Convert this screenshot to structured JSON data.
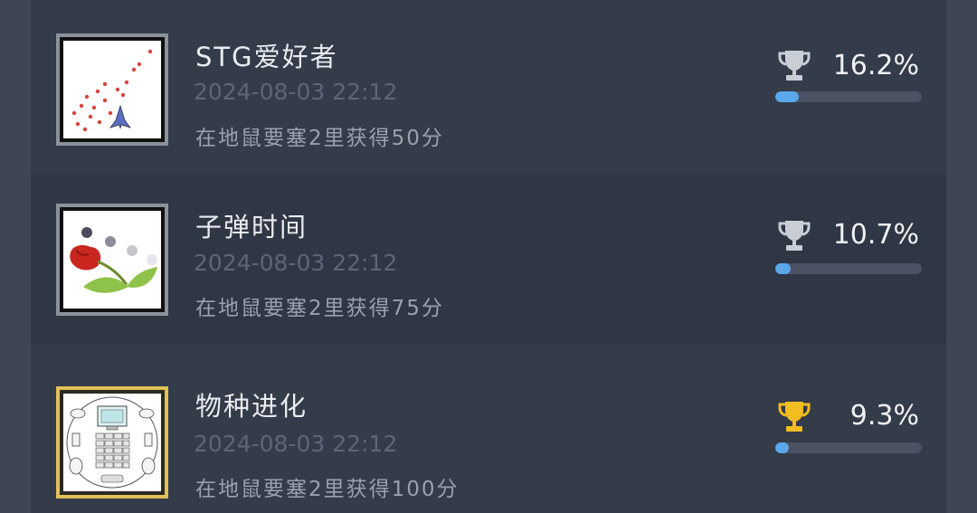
{
  "achievements": [
    {
      "title": "STG爱好者",
      "date": "2024-08-03 22:12",
      "description": "在地鼠要塞2里获得50分",
      "percent_label": "16.2%",
      "percent": 16.2,
      "trophy": "silver-trophy-icon",
      "thumbnail": "bullet-hell-ship-icon"
    },
    {
      "title": "子弹时间",
      "date": "2024-08-03 22:12",
      "description": "在地鼠要塞2里获得75分",
      "percent_label": "10.7%",
      "percent": 10.7,
      "trophy": "silver-trophy-icon",
      "thumbnail": "tulip-bullets-icon"
    },
    {
      "title": "物种进化",
      "date": "2024-08-03 22:12",
      "description": "在地鼠要塞2里获得100分",
      "percent_label": "9.3%",
      "percent": 9.3,
      "trophy": "gold-trophy-icon",
      "thumbnail": "computer-robot-icon"
    }
  ],
  "colors": {
    "bar_fill": "#5aa8ea",
    "silver_trophy": "#c9ced6",
    "gold_trophy": "#f2bd21",
    "gold_frame": "#e0c15a"
  }
}
